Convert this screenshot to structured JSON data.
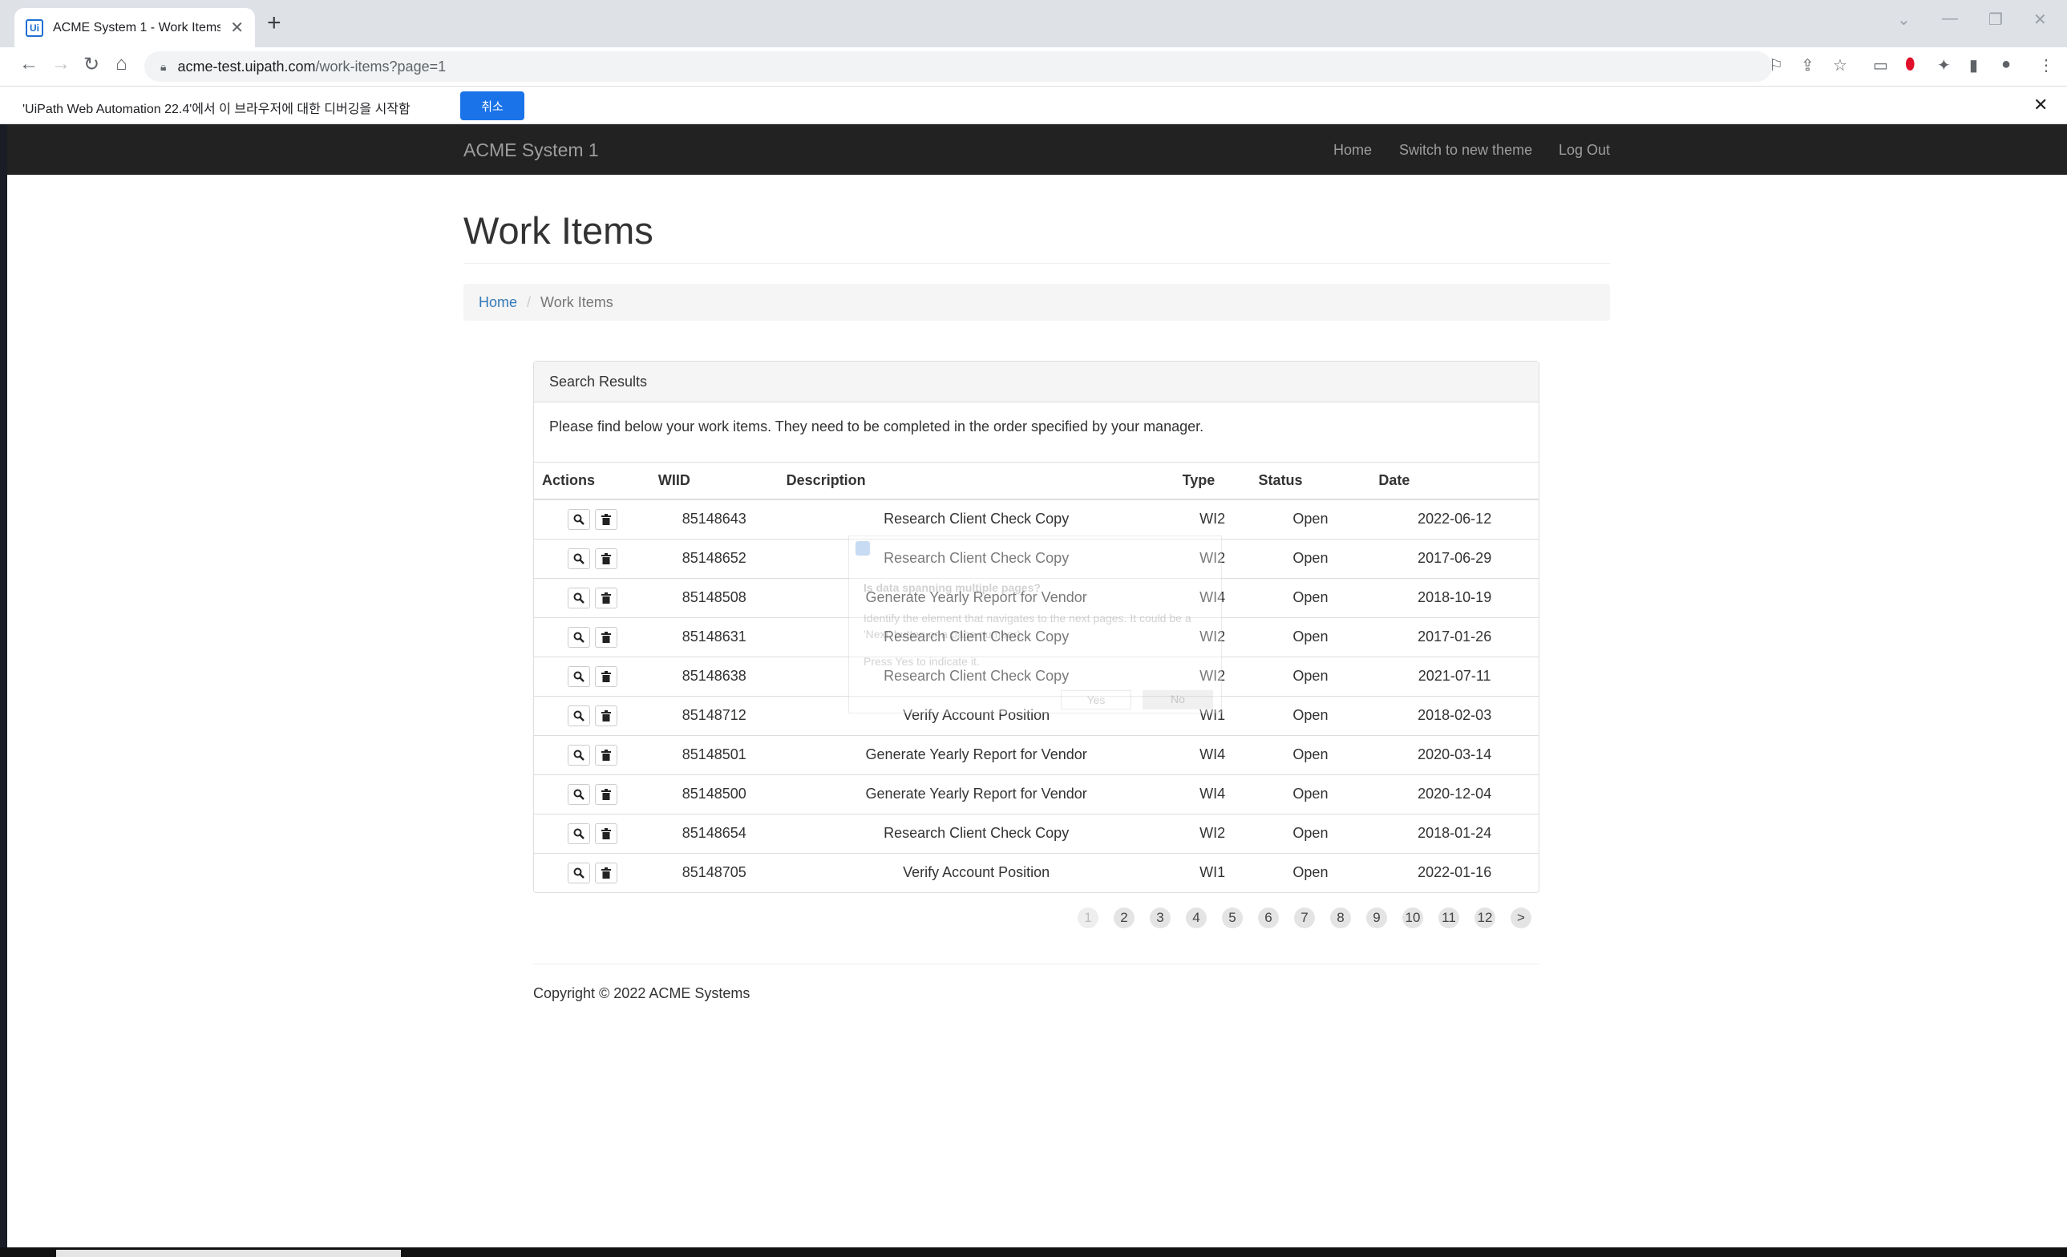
{
  "browser": {
    "tab_title": "ACME System 1 - Work Items",
    "favicon_text": "Ui",
    "url_host": "acme-test.uipath.com",
    "url_path": "/work-items?page=1"
  },
  "infobar": {
    "message": "'UiPath Web Automation 22.4'에서 이 브라우저에 대한 디버깅을 시작함",
    "cancel_label": "취소"
  },
  "navbar": {
    "brand": "ACME System 1",
    "links": [
      "Home",
      "Switch to new theme",
      "Log Out"
    ]
  },
  "page": {
    "title": "Work Items",
    "breadcrumb": {
      "home": "Home",
      "current": "Work Items"
    }
  },
  "panel": {
    "heading": "Search Results",
    "body": "Please find below your work items. They need to be completed in the order specified by your manager.",
    "columns": [
      "Actions",
      "WIID",
      "Description",
      "Type",
      "Status",
      "Date"
    ],
    "rows": [
      {
        "wiid": "85148643",
        "desc": "Research Client Check Copy",
        "type": "WI2",
        "status": "Open",
        "date": "2022-06-12"
      },
      {
        "wiid": "85148652",
        "desc": "Research Client Check Copy",
        "type": "WI2",
        "status": "Open",
        "date": "2017-06-29"
      },
      {
        "wiid": "85148508",
        "desc": "Generate Yearly Report for Vendor",
        "type": "WI4",
        "status": "Open",
        "date": "2018-10-19"
      },
      {
        "wiid": "85148631",
        "desc": "Research Client Check Copy",
        "type": "WI2",
        "status": "Open",
        "date": "2017-01-26"
      },
      {
        "wiid": "85148638",
        "desc": "Research Client Check Copy",
        "type": "WI2",
        "status": "Open",
        "date": "2021-07-11"
      },
      {
        "wiid": "85148712",
        "desc": "Verify Account Position",
        "type": "WI1",
        "status": "Open",
        "date": "2018-02-03"
      },
      {
        "wiid": "85148501",
        "desc": "Generate Yearly Report for Vendor",
        "type": "WI4",
        "status": "Open",
        "date": "2020-03-14"
      },
      {
        "wiid": "85148500",
        "desc": "Generate Yearly Report for Vendor",
        "type": "WI4",
        "status": "Open",
        "date": "2020-12-04"
      },
      {
        "wiid": "85148654",
        "desc": "Research Client Check Copy",
        "type": "WI2",
        "status": "Open",
        "date": "2018-01-24"
      },
      {
        "wiid": "85148705",
        "desc": "Verify Account Position",
        "type": "WI1",
        "status": "Open",
        "date": "2022-01-16"
      }
    ]
  },
  "pagination": {
    "pages": [
      "1",
      "2",
      "3",
      "4",
      "5",
      "6",
      "7",
      "8",
      "9",
      "10",
      "11",
      "12",
      ">"
    ],
    "current": "1"
  },
  "overlay": {
    "question": "Is data spanning multiple pages?",
    "description": "Identify the element that navigates to the next pages. It could be a 'Next' button or a page number).",
    "prompt": "Press Yes to indicate it.",
    "yes": "Yes",
    "no": "No"
  },
  "footer": {
    "copyright": "Copyright © 2022 ACME Systems"
  },
  "icons": {
    "view": "search-icon",
    "delete": "trash-icon"
  }
}
